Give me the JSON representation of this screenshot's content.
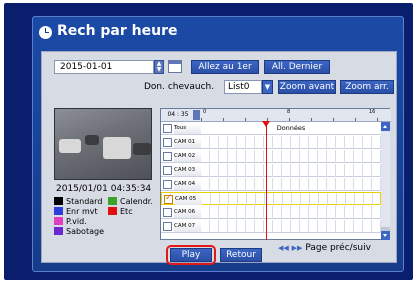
{
  "title": "Rech par heure",
  "date": {
    "value": "2015-01-01"
  },
  "buttons": {
    "goto_first": "Allez au 1er",
    "goto_last": "All. Dernier",
    "zoom_in": "Zoom avant",
    "zoom_out": "Zoom arr.",
    "play": "Play",
    "back": "Retour"
  },
  "overlap": {
    "label": "Don. chevauch.",
    "selected": "List0"
  },
  "camera_view": {
    "timestamp": "2015/01/01 04:35:34"
  },
  "legend": [
    {
      "label": "Standard",
      "color": "#000000"
    },
    {
      "label": "Calendr.",
      "color": "#3aa52a"
    },
    {
      "label": "Enr mvt",
      "color": "#2c3fd8"
    },
    {
      "label": "Etc",
      "color": "#e01010"
    },
    {
      "label": "P.vid.",
      "color": "#e040c0"
    },
    {
      "label": "Sabotage",
      "color": "#6a2ad0"
    }
  ],
  "timeline": {
    "time": "04 : 35",
    "ticks": [
      "0",
      "8",
      "16"
    ],
    "data_header": "Données",
    "all_label": "Tous",
    "cameras": [
      {
        "name": "CAM 01",
        "checked": false
      },
      {
        "name": "CAM 02",
        "checked": false
      },
      {
        "name": "CAM 03",
        "checked": false
      },
      {
        "name": "CAM 04",
        "checked": false
      },
      {
        "name": "CAM 05",
        "checked": true
      },
      {
        "name": "CAM 06",
        "checked": false
      },
      {
        "name": "CAM 07",
        "checked": false
      }
    ]
  },
  "page_nav": "Page préc/suiv"
}
